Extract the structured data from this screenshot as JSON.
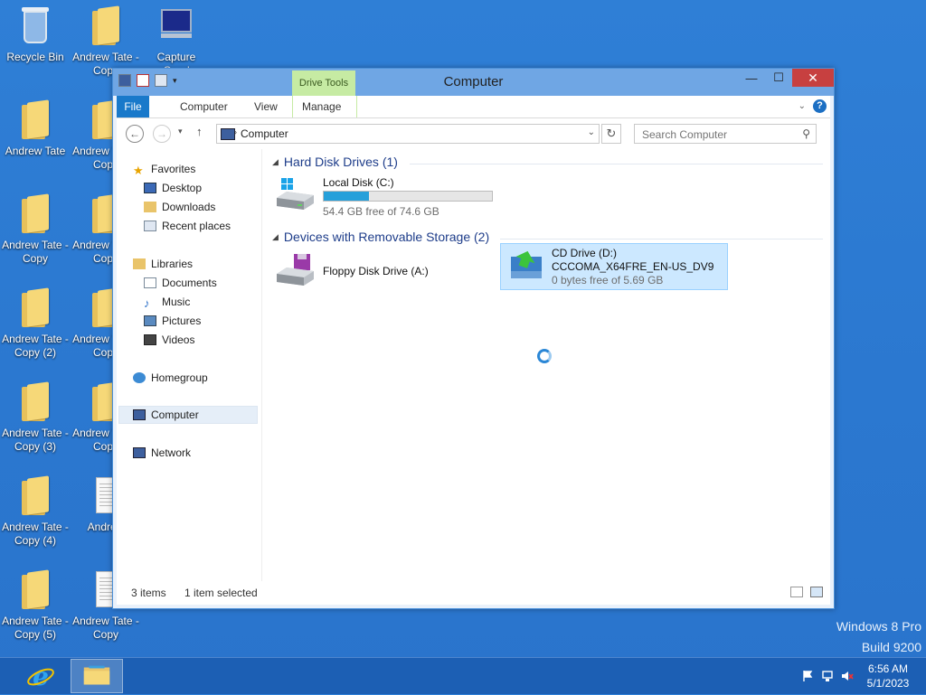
{
  "desktop": {
    "icons": [
      {
        "name": "recycle-bin",
        "label": "Recycle Bin"
      },
      {
        "name": "andrew-tate-copy-top",
        "label": "Andrew Tate - Copy"
      },
      {
        "name": "capture-good",
        "label": "Capture Good"
      },
      {
        "name": "andrew-tate-1",
        "label": "Andrew Tate"
      },
      {
        "name": "andrew-tate-copy-2col",
        "label": "Andrew Tate - Copy"
      },
      {
        "name": "andrew-tate-copy-1",
        "label": "Andrew Tate - Copy"
      },
      {
        "name": "andrew-tate-copy-3col",
        "label": "Andrew Tate - Copy"
      },
      {
        "name": "andrew-tate-copy-2",
        "label": "Andrew Tate - Copy (2)"
      },
      {
        "name": "andrew-tate-copy-4col",
        "label": "Andrew Tate - Copy"
      },
      {
        "name": "andrew-tate-copy-3",
        "label": "Andrew Tate - Copy (3)"
      },
      {
        "name": "andrew-tate-copy-5col",
        "label": "Andrew Tate - Copy"
      },
      {
        "name": "andrew-tate-copy-4",
        "label": "Andrew Tate - Copy (4)"
      },
      {
        "name": "andrew-doc",
        "label": "Andrew"
      },
      {
        "name": "andrew-tate-copy-5",
        "label": "Andrew Tate - Copy (5)"
      },
      {
        "name": "andrew-tate-copy-doc",
        "label": "Andrew Tate - Copy"
      }
    ]
  },
  "window": {
    "title": "Computer",
    "context_tab_header": "Drive Tools",
    "ribbon_tabs": [
      "File",
      "Computer",
      "View",
      "Manage"
    ],
    "address": {
      "crumb": "Computer"
    },
    "search": {
      "placeholder": "Search Computer"
    },
    "nav_pane": {
      "favorites": "Favorites",
      "desktop": "Desktop",
      "downloads": "Downloads",
      "recent": "Recent places",
      "libraries": "Libraries",
      "documents": "Documents",
      "music": "Music",
      "pictures": "Pictures",
      "videos": "Videos",
      "homegroup": "Homegroup",
      "computer": "Computer",
      "network": "Network"
    },
    "groups": {
      "hdd": {
        "header": "Hard Disk Drives (1)",
        "local_disk": {
          "name": "Local Disk (C:)",
          "free": "54.4 GB free of 74.6 GB",
          "used_fraction": 0.27
        }
      },
      "removable": {
        "header": "Devices with Removable Storage (2)",
        "floppy": {
          "name": "Floppy Disk Drive (A:)"
        },
        "cd": {
          "name": "CD Drive (D:)",
          "label": "CCCOMA_X64FRE_EN-US_DV9",
          "free": "0 bytes free of 5.69 GB"
        }
      }
    },
    "status": {
      "items": "3 items",
      "selected": "1 item selected"
    }
  },
  "watermark": {
    "line1": "Windows 8 Pro",
    "line2": "Build 9200"
  },
  "taskbar": {
    "time": "6:56 AM",
    "date": "5/1/2023"
  },
  "colors": {
    "accent": "#1979ca",
    "progress": "#26a0da",
    "close": "#c74040",
    "context_tab": "#c6eba3"
  }
}
